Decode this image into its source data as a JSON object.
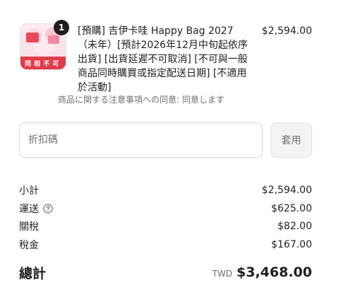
{
  "line_item": {
    "quantity": "1",
    "thumbnail_caption": "同 相 不 可",
    "title": "[預購] 吉伊卡哇 Happy Bag 2027（未年）[預計2026年12月中旬起依序出貨] [出貨延遲不可取消] [不可與一般商品同時購買或指定配送日期] [不適用於活動]",
    "note": "商品に関する注意事項への同意: 同意します",
    "price": "$2,594.00"
  },
  "discount": {
    "placeholder": "折扣碼",
    "value": "",
    "apply_label": "套用"
  },
  "summary": {
    "subtotal_label": "小計",
    "subtotal_value": "$2,594.00",
    "shipping_label": "運送",
    "shipping_value": "$625.00",
    "duties_label": "關稅",
    "duties_value": "$82.00",
    "taxes_label": "稅金",
    "taxes_value": "$167.00",
    "total_label": "總計",
    "currency": "TWD",
    "total_value": "$3,468.00"
  },
  "icons": {
    "shipping_help": "question-circle-icon"
  },
  "colors": {
    "text": "#1f1f1f",
    "muted": "#707070",
    "badge": "#1e1e1e",
    "button_bg": "#f3f3f3",
    "border": "#d6d6d6"
  }
}
